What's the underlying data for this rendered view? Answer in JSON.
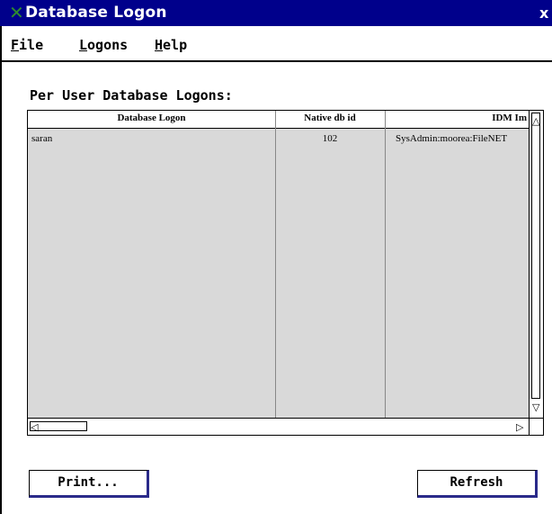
{
  "window": {
    "title": "Database Logon",
    "icon": "x-app-icon",
    "close_glyph": "x"
  },
  "menu": {
    "items": [
      {
        "label": "File",
        "mnemonic": "F",
        "rest": "ile"
      },
      {
        "label": "Logons",
        "mnemonic": "L",
        "rest": "ogons"
      },
      {
        "label": "Help",
        "mnemonic": "H",
        "rest": "elp"
      }
    ]
  },
  "section_label": "Per User Database Logons:",
  "table": {
    "columns": [
      "Database Logon",
      "Native db id",
      "IDM Im"
    ],
    "rows": [
      [
        "saran",
        "102",
        "SysAdmin:moorea:FileNET"
      ]
    ]
  },
  "buttons": {
    "print_label": "Print...",
    "refresh_label": "Refresh"
  },
  "colors": {
    "titlebar": "#00008b",
    "table_bg": "#d9d9d9",
    "button_shadow": "#2a2a8a"
  }
}
